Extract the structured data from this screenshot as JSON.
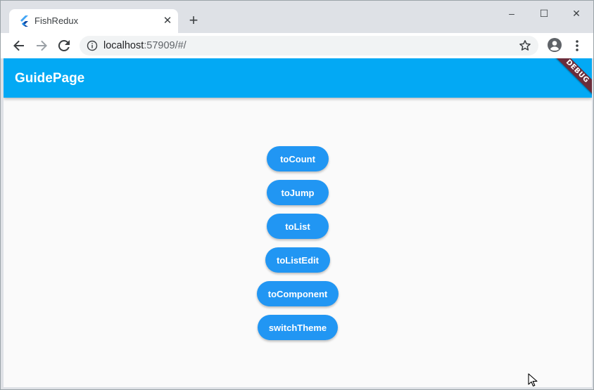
{
  "browser": {
    "tab": {
      "title": "FishRedux",
      "close_glyph": "✕"
    },
    "newtab_glyph": "+",
    "window_controls": {
      "minimize": "–",
      "maximize": "☐",
      "close": "✕"
    },
    "address": {
      "host": "localhost",
      "path": ":57909/#/"
    },
    "icons": {
      "back": "arrow-left-icon",
      "forward": "arrow-right-icon",
      "reload": "reload-icon",
      "info": "info-icon",
      "star": "star-icon",
      "profile": "profile-icon",
      "menu": "kebab-menu-icon"
    }
  },
  "app": {
    "title": "GuidePage",
    "debug_banner": "DEBUG",
    "colors": {
      "appbar": "#03a9f4",
      "button": "#2196f3",
      "background": "#fafafa"
    },
    "buttons": [
      {
        "label": "toCount"
      },
      {
        "label": "toJump"
      },
      {
        "label": "toList"
      },
      {
        "label": "toListEdit"
      },
      {
        "label": "toComponent"
      },
      {
        "label": "switchTheme"
      }
    ]
  }
}
